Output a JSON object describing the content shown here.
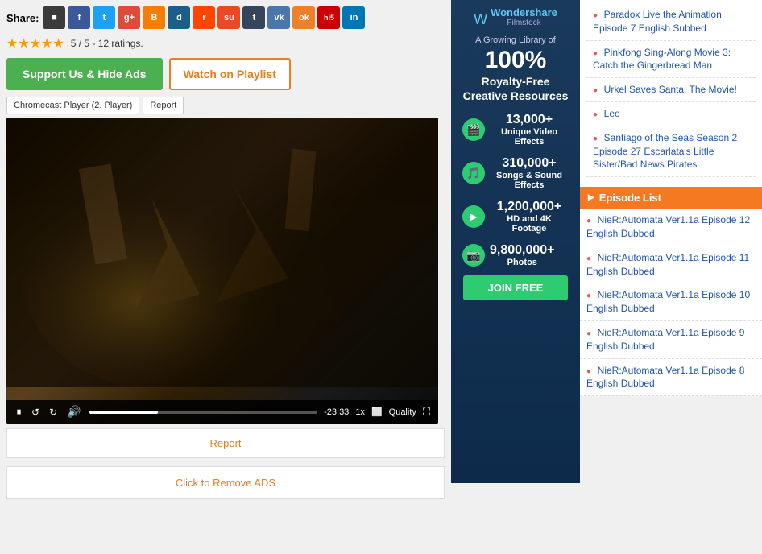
{
  "share": {
    "label": "Share:",
    "icons": [
      {
        "name": "square",
        "class": "si-square",
        "symbol": "■"
      },
      {
        "name": "facebook",
        "class": "si-fb",
        "symbol": "f"
      },
      {
        "name": "twitter",
        "class": "si-tw",
        "symbol": "t"
      },
      {
        "name": "google-plus",
        "class": "si-gp",
        "symbol": "g+"
      },
      {
        "name": "blogger",
        "class": "si-bl",
        "symbol": "B"
      },
      {
        "name": "digg",
        "class": "si-digg",
        "symbol": "d"
      },
      {
        "name": "reddit",
        "class": "si-reddit",
        "symbol": "r"
      },
      {
        "name": "stumbleupon",
        "class": "si-su",
        "symbol": "su"
      },
      {
        "name": "tumblr",
        "class": "si-tumblr",
        "symbol": "t"
      },
      {
        "name": "vk",
        "class": "si-vk",
        "symbol": "vk"
      },
      {
        "name": "ok",
        "class": "si-ok",
        "symbol": "ok"
      },
      {
        "name": "hi5",
        "class": "si-hi5",
        "symbol": "hi5"
      },
      {
        "name": "linkedin",
        "class": "si-in",
        "symbol": "in"
      }
    ]
  },
  "rating": {
    "stars": "★★★★★",
    "text": "5 / 5 - 12 ratings."
  },
  "buttons": {
    "support": "Support Us & Hide Ads",
    "watch_playlist": "Watch on Playlist"
  },
  "player": {
    "label_chromecast": "Chromecast Player (2. Player)",
    "label_report": "Report",
    "time": "-23:33",
    "speed": "1x"
  },
  "report_btn": "Report",
  "remove_ads_btn": "Click to Remove ADS",
  "ad": {
    "logo": "Wondershare",
    "subtitle": "Filmstock",
    "tagline": "A Growing Library of",
    "pct_label": "100%",
    "headline": "Royalty-Free\nCreative Resources",
    "features": [
      {
        "icon": "🎬",
        "count": "13,000+",
        "label": "Unique Video Effects"
      },
      {
        "icon": "🎵",
        "count": "310,000+",
        "label": "Songs & Sound Effects"
      },
      {
        "icon": "▶",
        "count": "1,200,000+",
        "label": "HD and 4K Footage"
      },
      {
        "icon": "📷",
        "count": "9,800,000+",
        "label": "Photos"
      }
    ],
    "join_btn": "JOIN FREE"
  },
  "related_videos": [
    {
      "title": "Paradox Live the Animation Episode 7 English Subbed"
    },
    {
      "title": "Pinkfong Sing-Along Movie 3: Catch the Gingerbread Man"
    },
    {
      "title": "Urkel Saves Santa: The Movie!"
    },
    {
      "title": "Leo"
    },
    {
      "title": "Santiago of the Seas Season 2 Episode 27 Escarlata's Little Sister/Bad News Pirates"
    }
  ],
  "episode_list": {
    "header": "Episode List",
    "episodes": [
      {
        "title": "NieR:Automata Ver1.1a Episode 12 English Dubbed"
      },
      {
        "title": "NieR:Automata Ver1.1a Episode 11 English Dubbed"
      },
      {
        "title": "NieR:Automata Ver1.1a Episode 10 English Dubbed"
      },
      {
        "title": "NieR:Automata Ver1.1a Episode 9 English Dubbed"
      },
      {
        "title": "NieR:Automata Ver1.1a Episode 8 English Dubbed"
      }
    ]
  }
}
